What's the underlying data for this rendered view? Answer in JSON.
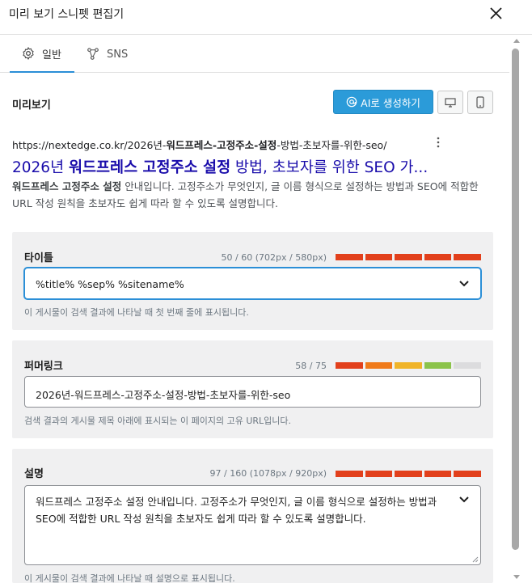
{
  "header": {
    "title": "미리 보기 스니펫 편집기"
  },
  "tabs": [
    {
      "label": "일반",
      "icon": "gear-icon",
      "active": true
    },
    {
      "label": "SNS",
      "icon": "share-nodes-icon",
      "active": false
    }
  ],
  "preview": {
    "label": "미리보기",
    "ai_button": "AI로 생성하기",
    "desktop_icon": "desktop-icon",
    "mobile_icon": "mobile-icon"
  },
  "snippet": {
    "url_prefix": "https://nextedge.co.kr/2026년-",
    "url_bold": "워드프레스-고정주소-설정",
    "url_suffix": "-방법-초보자를-위한-seo/",
    "title_prefix": "2026년 ",
    "title_bold": "워드프레스 고정주소 설정",
    "title_suffix": " 방법, 초보자를 위한 SEO 가...",
    "desc_bold": "워드프레스 고정주소 설정",
    "desc_rest": " 안내입니다. 고정주소가 무엇인지, 글 이름 형식으로 설정하는 방법과 SEO에 적합한 URL 작성 원칙을 초보자도 쉽게 따라 할 수 있도록 설명합니다."
  },
  "title_card": {
    "label": "타이틀",
    "count": "50 / 60 (702px / 580px)",
    "value": "%title% %sep% %sitename%",
    "hint": "이 게시물이 검색 결과에 나타날 때 첫 번째 줄에 표시됩니다.",
    "segments": [
      "#e2401c",
      "#e2401c",
      "#e2401c",
      "#e2401c",
      "#e2401c"
    ]
  },
  "permalink_card": {
    "label": "퍼머링크",
    "count": "58 / 75",
    "value": "2026년-워드프레스-고정주소-설정-방법-초보자를-위한-seo",
    "hint": "검색 결과의 게시물 제목 아래에 표시되는 이 페이지의 고유 URL입니다.",
    "segments": [
      "#e2401c",
      "#f07a1a",
      "#f0b429",
      "#8bc34a",
      "#dcdcde"
    ]
  },
  "desc_card": {
    "label": "설명",
    "count": "97 / 160 (1078px / 920px)",
    "value": "워드프레스 고정주소 설정 안내입니다. 고정주소가 무엇인지, 글 이름 형식으로 설정하는 방법과 SEO에 적합한 URL 작성 원칙을 초보자도 쉽게 따라 할 수 있도록 설명합니다.",
    "hint": "이 게시물이 검색 결과에 나타날 때 설명으로 표시됩니다.",
    "segments": [
      "#e2401c",
      "#e2401c",
      "#e2401c",
      "#e2401c",
      "#e2401c"
    ]
  }
}
